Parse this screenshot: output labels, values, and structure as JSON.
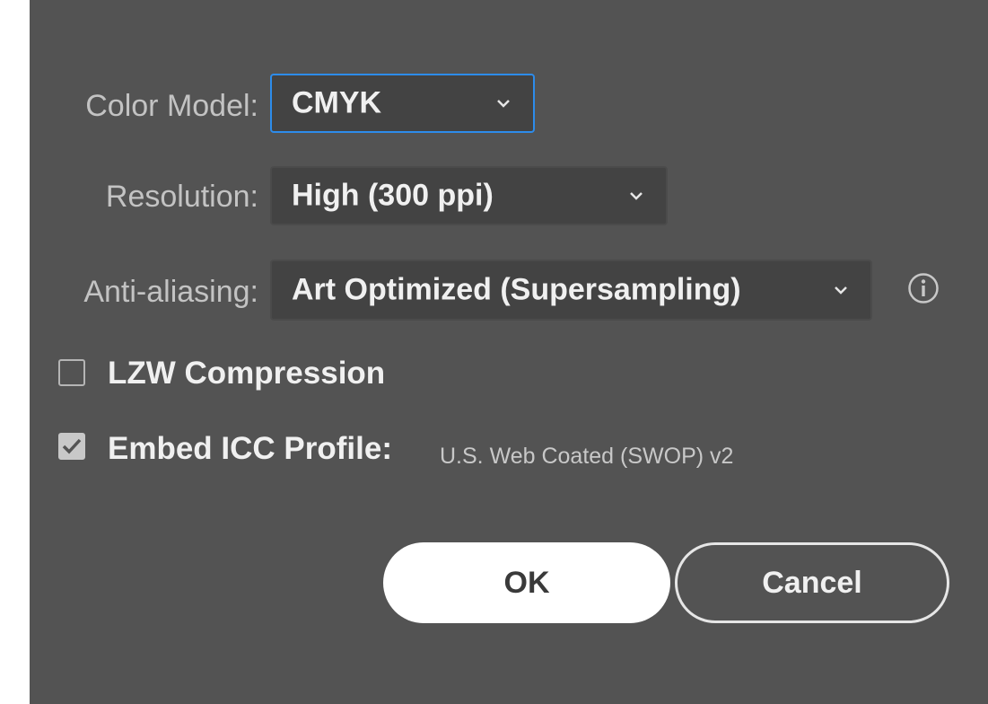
{
  "dialog": {
    "color_model": {
      "label": "Color Model:",
      "value": "CMYK"
    },
    "resolution": {
      "label": "Resolution:",
      "value": "High (300 ppi)"
    },
    "anti_aliasing": {
      "label": "Anti-aliasing:",
      "value": "Art Optimized (Supersampling)",
      "info_icon": "info-icon"
    },
    "lzw_compression": {
      "label": "LZW Compression",
      "checked": false
    },
    "embed_icc": {
      "label": "Embed ICC Profile:",
      "checked": true,
      "profile": "U.S. Web Coated (SWOP) v2"
    },
    "buttons": {
      "ok": "OK",
      "cancel": "Cancel"
    }
  },
  "colors": {
    "panel_bg": "#535353",
    "focus_accent": "#2d8ceb",
    "primary_button_bg": "#ffffff"
  }
}
